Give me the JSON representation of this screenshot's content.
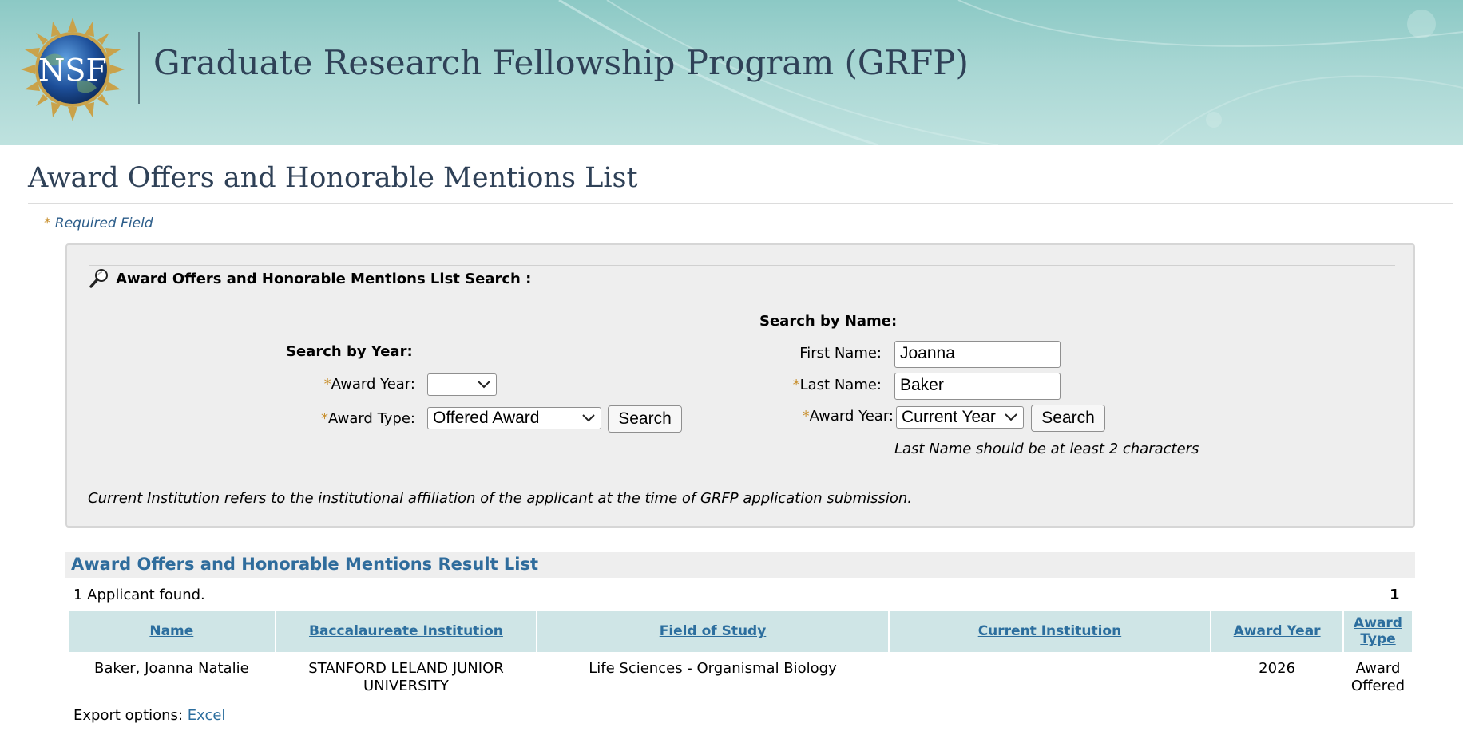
{
  "header": {
    "logo_text": "NSF",
    "app_title": "Graduate Research Fellowship Program (GRFP)"
  },
  "page": {
    "title": "Award Offers and Honorable Mentions List",
    "required_star": "*",
    "required_text": "Required Field"
  },
  "search_panel": {
    "title": "Award Offers and Honorable Mentions List Search :",
    "by_year": {
      "heading": "Search by Year:",
      "award_year_label": "Award Year:",
      "award_year_value": "",
      "award_type_label": "Award Type:",
      "award_type_value": "Offered Award",
      "search_button": "Search"
    },
    "by_name": {
      "heading": "Search by Name:",
      "first_name_label": "First Name:",
      "first_name_value": "Joanna",
      "last_name_label": "Last Name:",
      "last_name_value": "Baker",
      "award_year_label": "Award Year:",
      "award_year_value": "Current Year",
      "search_button": "Search",
      "hint": "Last Name should be at least 2 characters"
    },
    "note": "Current Institution refers to the institutional affiliation of the applicant at the time of GRFP application submission."
  },
  "results": {
    "title": "Award Offers and Honorable Mentions Result List",
    "found_text": "1 Applicant found.",
    "page_number": "1",
    "columns": [
      "Name",
      "Baccalaureate Institution",
      "Field of Study",
      "Current Institution",
      "Award Year",
      "Award Type"
    ],
    "rows": [
      {
        "name": "Baker, Joanna Natalie",
        "baccalaureate": "STANFORD LELAND JUNIOR UNIVERSITY",
        "field": "Life Sciences - Organismal Biology",
        "current_institution": "",
        "award_year": "2026",
        "award_type": "Award Offered"
      }
    ],
    "export_label": "Export options:",
    "export_link": "Excel"
  },
  "colors": {
    "banner": "#a7d6d3",
    "title_text": "#2f4157",
    "link": "#2c6e9e",
    "required_star": "#c8902f",
    "panel_bg": "#eeeeee",
    "table_header_bg": "#cfe5e6"
  },
  "icons": {
    "logo": "nsf-logo",
    "search_panel": "magnifier-icon",
    "select": "chevron-down-icon"
  }
}
